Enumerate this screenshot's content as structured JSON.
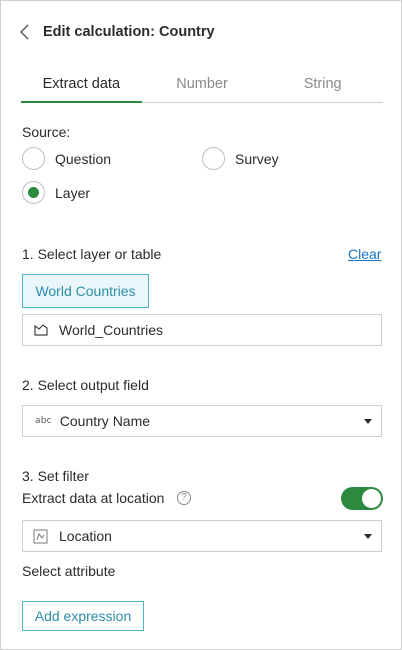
{
  "header": {
    "title": "Edit calculation: Country",
    "back_icon": "chevron-left-icon"
  },
  "tabs": [
    {
      "label": "Extract data",
      "active": true
    },
    {
      "label": "Number",
      "active": false
    },
    {
      "label": "String",
      "active": false
    }
  ],
  "source": {
    "label": "Source:",
    "options": [
      {
        "label": "Question",
        "selected": false
      },
      {
        "label": "Survey",
        "selected": false
      },
      {
        "label": "Layer",
        "selected": true
      }
    ]
  },
  "step1": {
    "label": "1. Select layer or table",
    "clear_link": "Clear",
    "chip_label": "World Countries",
    "layer_value": "World_Countries",
    "layer_icon": "polygon-layer-icon"
  },
  "step2": {
    "label": "2. Select output field",
    "field_type": "abc",
    "field_value": "Country Name"
  },
  "step3": {
    "label": "3. Set filter",
    "location_toggle_label": "Extract data at location",
    "help_symbol": "?",
    "location_toggle_on": true,
    "location_value": "Location",
    "location_icon": "location-field-icon",
    "attribute_label": "Select attribute",
    "add_expression_label": "Add expression"
  },
  "colors": {
    "accent_green": "#2b8a3e",
    "accent_teal": "#4fb6c9",
    "link_blue": "#1a73c2"
  }
}
